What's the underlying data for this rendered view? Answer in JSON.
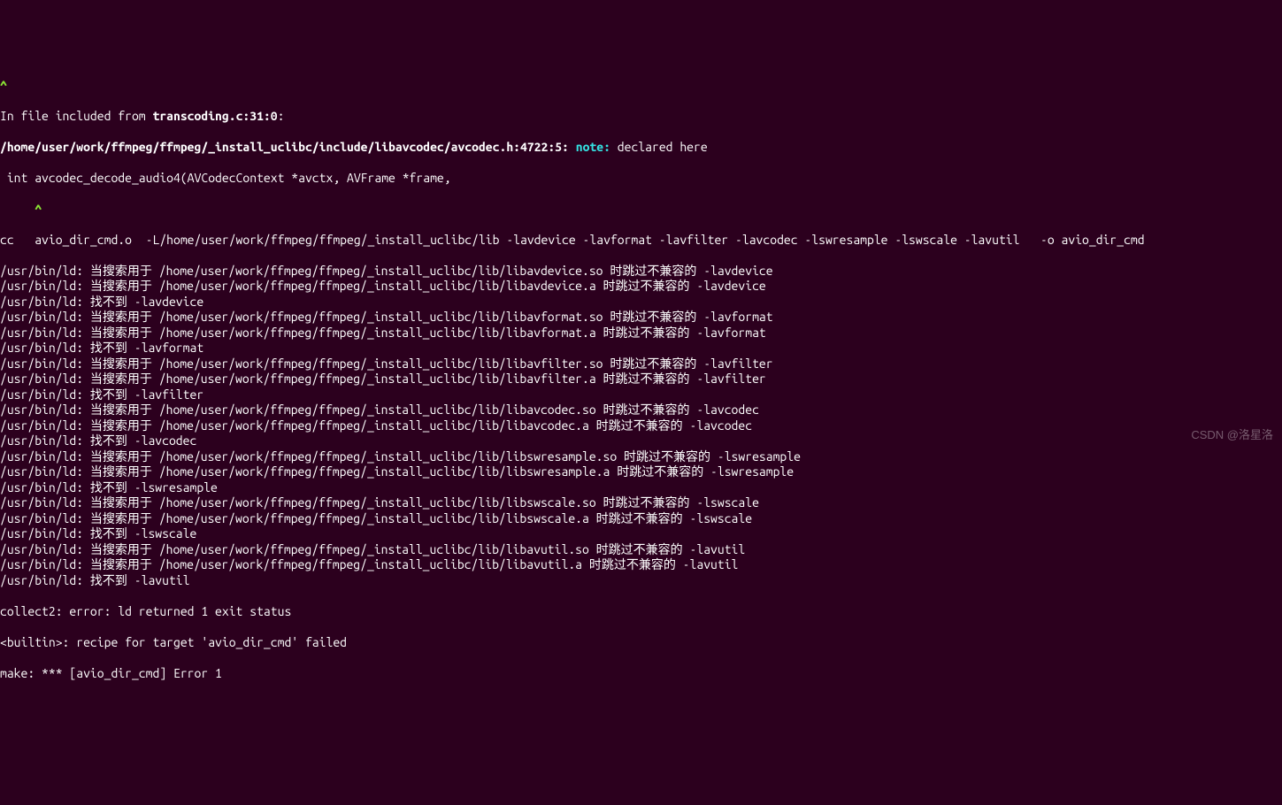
{
  "caret": "^",
  "included_from": {
    "prefix": "In file included from ",
    "file": "transcoding.c:31:0",
    "suffix": ":"
  },
  "header_loc": {
    "path": "/home/user/work/ffmpeg/ffmpeg/_install_uclibc/include/libavcodec/avcodec.h:4722:5:",
    "note_label": " note: ",
    "note_text": "declared here"
  },
  "decl_line": " int avcodec_decode_audio4(AVCodecContext *avctx, AVFrame *frame,",
  "caret2": "     ^",
  "cc_line": "cc   avio_dir_cmd.o  -L/home/user/work/ffmpeg/ffmpeg/_install_uclibc/lib -lavdevice -lavformat -lavfilter -lavcodec -lswresample -lswscale -lavutil   -o avio_dir_cmd",
  "ld_lines": [
    "/usr/bin/ld: 当搜索用于 /home/user/work/ffmpeg/ffmpeg/_install_uclibc/lib/libavdevice.so 时跳过不兼容的 -lavdevice",
    "/usr/bin/ld: 当搜索用于 /home/user/work/ffmpeg/ffmpeg/_install_uclibc/lib/libavdevice.a 时跳过不兼容的 -lavdevice",
    "/usr/bin/ld: 找不到 -lavdevice",
    "/usr/bin/ld: 当搜索用于 /home/user/work/ffmpeg/ffmpeg/_install_uclibc/lib/libavformat.so 时跳过不兼容的 -lavformat",
    "/usr/bin/ld: 当搜索用于 /home/user/work/ffmpeg/ffmpeg/_install_uclibc/lib/libavformat.a 时跳过不兼容的 -lavformat",
    "/usr/bin/ld: 找不到 -lavformat",
    "/usr/bin/ld: 当搜索用于 /home/user/work/ffmpeg/ffmpeg/_install_uclibc/lib/libavfilter.so 时跳过不兼容的 -lavfilter",
    "/usr/bin/ld: 当搜索用于 /home/user/work/ffmpeg/ffmpeg/_install_uclibc/lib/libavfilter.a 时跳过不兼容的 -lavfilter",
    "/usr/bin/ld: 找不到 -lavfilter",
    "/usr/bin/ld: 当搜索用于 /home/user/work/ffmpeg/ffmpeg/_install_uclibc/lib/libavcodec.so 时跳过不兼容的 -lavcodec",
    "/usr/bin/ld: 当搜索用于 /home/user/work/ffmpeg/ffmpeg/_install_uclibc/lib/libavcodec.a 时跳过不兼容的 -lavcodec",
    "/usr/bin/ld: 找不到 -lavcodec",
    "/usr/bin/ld: 当搜索用于 /home/user/work/ffmpeg/ffmpeg/_install_uclibc/lib/libswresample.so 时跳过不兼容的 -lswresample",
    "/usr/bin/ld: 当搜索用于 /home/user/work/ffmpeg/ffmpeg/_install_uclibc/lib/libswresample.a 时跳过不兼容的 -lswresample",
    "/usr/bin/ld: 找不到 -lswresample",
    "/usr/bin/ld: 当搜索用于 /home/user/work/ffmpeg/ffmpeg/_install_uclibc/lib/libswscale.so 时跳过不兼容的 -lswscale",
    "/usr/bin/ld: 当搜索用于 /home/user/work/ffmpeg/ffmpeg/_install_uclibc/lib/libswscale.a 时跳过不兼容的 -lswscale",
    "/usr/bin/ld: 找不到 -lswscale",
    "/usr/bin/ld: 当搜索用于 /home/user/work/ffmpeg/ffmpeg/_install_uclibc/lib/libavutil.so 时跳过不兼容的 -lavutil",
    "/usr/bin/ld: 当搜索用于 /home/user/work/ffmpeg/ffmpeg/_install_uclibc/lib/libavutil.a 时跳过不兼容的 -lavutil",
    "/usr/bin/ld: 找不到 -lavutil"
  ],
  "collect2": "collect2: error: ld returned 1 exit status",
  "recipe": "<builtin>: recipe for target 'avio_dir_cmd' failed",
  "make_err": "make: *** [avio_dir_cmd] Error 1",
  "watermark": "CSDN @洛星洛"
}
